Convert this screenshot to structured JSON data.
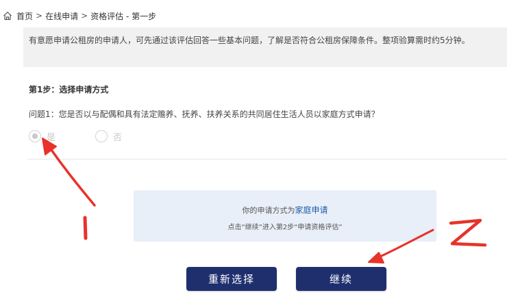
{
  "breadcrumb": {
    "home": "首页",
    "separator": ">",
    "online_apply": "在线申请",
    "current": "资格评估 - 第一步"
  },
  "notice": {
    "text": "有意愿申请公租房的申请人，可先通过该评估回答一些基本问题，了解是否符合公租房保障条件。整项验算需时约5分钟。"
  },
  "step": {
    "title": "第1步：选择申请方式"
  },
  "question": {
    "text": "问题1：您是否以与配偶和具有法定赡养、抚养、扶养关系的共同居住生活人员以家庭方式申请？",
    "options": [
      {
        "label": "是",
        "selected": true
      },
      {
        "label": "否",
        "selected": false
      }
    ]
  },
  "result": {
    "prefix": "你的申请方式为",
    "mode": "家庭申请",
    "hint": "点击“继续”进入第2步“申请资格评估”"
  },
  "buttons": {
    "reselect": "重新选择",
    "continue": "继续"
  },
  "annotations": {
    "mark1": "1",
    "mark2": "2",
    "color": "#e8322a"
  },
  "colors": {
    "button_bg": "#1f2f6e",
    "result_bg": "#e8eff8",
    "highlight": "#1f5aa8"
  }
}
